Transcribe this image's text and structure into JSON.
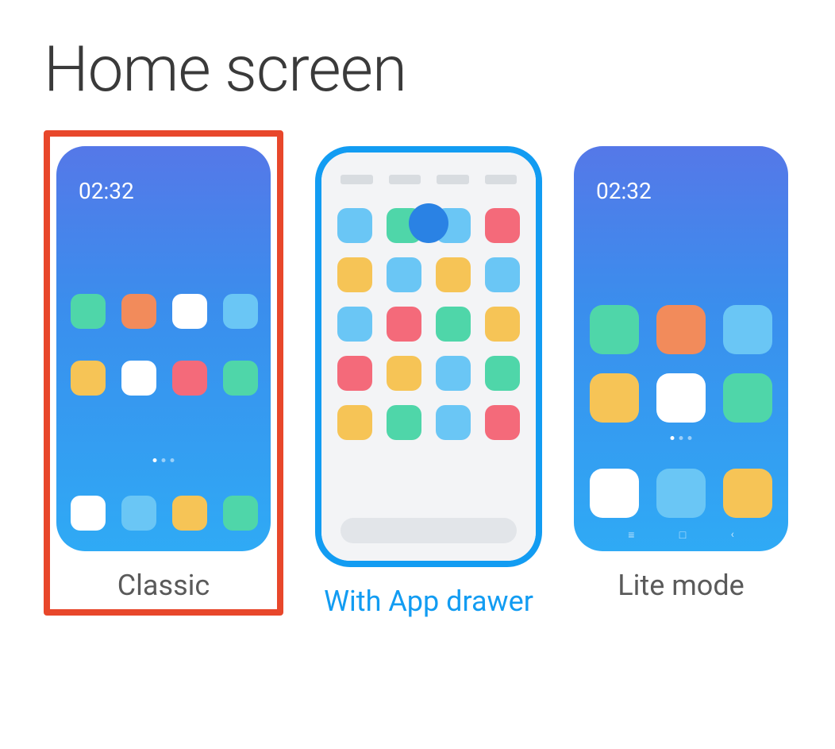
{
  "title": "Home screen",
  "options": {
    "classic": {
      "label": "Classic",
      "clock": "02:32",
      "highlighted": true,
      "selected": false
    },
    "drawer": {
      "label": "With App drawer",
      "highlighted": false,
      "selected": true
    },
    "lite": {
      "label": "Lite mode",
      "clock": "02:32",
      "highlighted": false,
      "selected": false
    }
  },
  "colors": {
    "highlight_border": "#e8472b",
    "selected_border": "#129cf2",
    "selected_text": "#129cf2"
  }
}
